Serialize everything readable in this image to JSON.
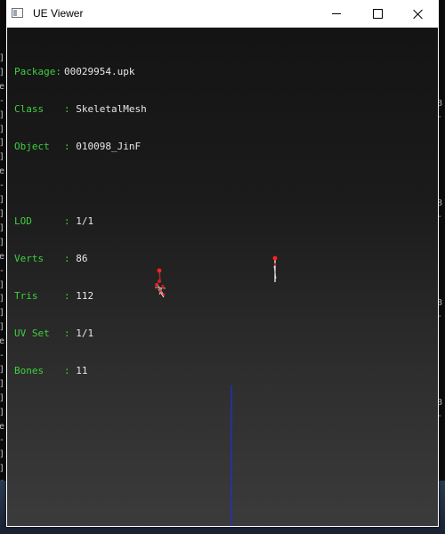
{
  "window": {
    "title": "UE Viewer",
    "icon": "app-window-icon"
  },
  "titlebar_buttons": [
    {
      "name": "minimize-button",
      "icon": "minimize-icon"
    },
    {
      "name": "maximize-button",
      "icon": "maximize-icon"
    },
    {
      "name": "close-button",
      "icon": "close-icon"
    }
  ],
  "info": {
    "package_label": "Package:",
    "package_value": "00029954.upk",
    "class_label": "Class",
    "class_value": "SkeletalMesh",
    "object_label": "Object",
    "object_value": "010098_JinF",
    "lod_label": "LOD",
    "lod_value": "1/1",
    "verts_label": "Verts",
    "verts_value": "86",
    "tris_label": "Tris",
    "tris_value": "112",
    "uvset_label": "UV Set",
    "uvset_value": "1/1",
    "bones_label": "Bones",
    "bones_value": "11",
    "separator": ":"
  },
  "background_console": {
    "left_glyphs": [
      "]",
      "]",
      "e",
      "-",
      "]",
      "]",
      "]",
      "]",
      "e",
      "-",
      "]",
      "]",
      "]",
      "]",
      "e",
      "-",
      "]",
      "]",
      "]",
      "]",
      "e",
      "-",
      "]",
      "]",
      "]",
      "]",
      "e",
      "-",
      "]",
      "]",
      "e",
      "-",
      "]"
    ],
    "right_glyphs": [
      "8",
      "-",
      "8",
      "-",
      "8",
      "-",
      "8",
      "-"
    ]
  },
  "colors": {
    "label": "#3fcf3f",
    "value": "#e8e8e8",
    "axis": "#1f2fd6",
    "bone_joint": "#ff2020"
  }
}
